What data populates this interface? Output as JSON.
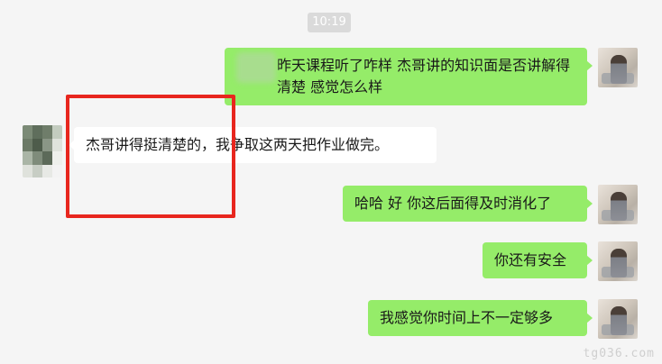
{
  "chat": {
    "timestamp": "10:19",
    "messages": [
      {
        "side": "right",
        "text": "昨天课程听了咋样 杰哥讲的知识面是否讲解得清楚 感觉怎么样"
      },
      {
        "side": "left",
        "text": "杰哥讲得挺清楚的，我争取这两天把作业做完。"
      },
      {
        "side": "right",
        "text": "哈哈 好 你这后面得及时消化了"
      },
      {
        "side": "right",
        "text": "你还有安全"
      },
      {
        "side": "right",
        "text": "我感觉你时间上不一定够多"
      }
    ]
  },
  "watermark": "tg036.com",
  "colors": {
    "background": "#f5f5f5",
    "sent_bubble": "#95ec69",
    "received_bubble": "#ffffff",
    "highlight_box": "#e8261e"
  },
  "icons": {
    "self_avatar": "user-photo-avatar",
    "contact_avatar": "pixelated-avatar"
  }
}
